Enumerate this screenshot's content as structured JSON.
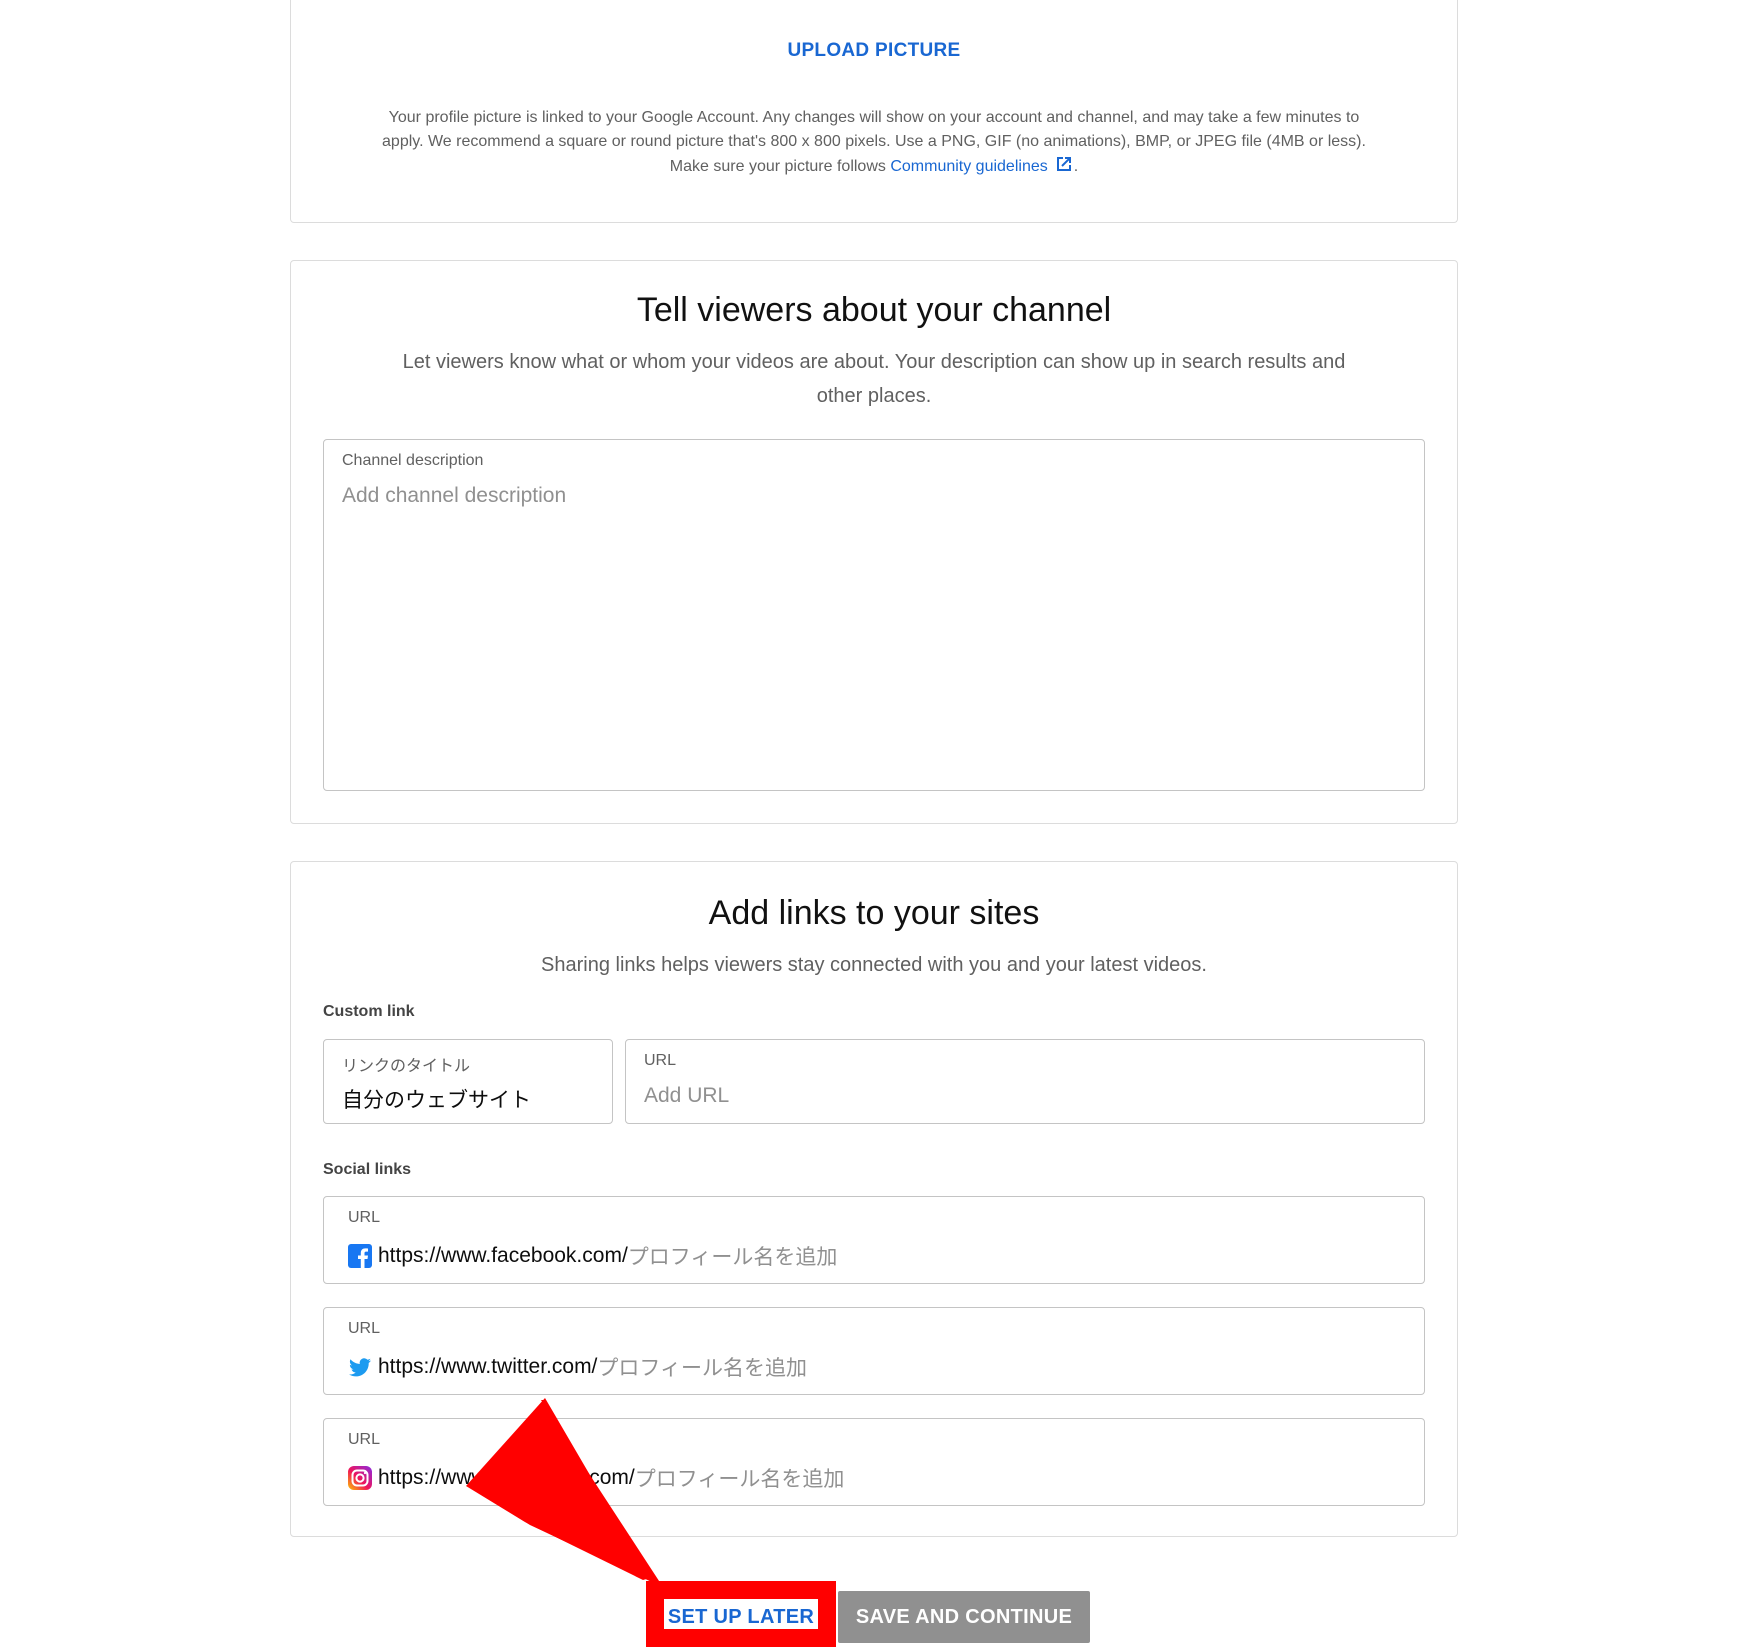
{
  "profile_picture": {
    "upload_label": "UPLOAD PICTURE",
    "help_line1": "Your profile picture is linked to your Google Account. Any changes will show on your account and channel, and may take a few minutes to",
    "help_line2": "apply. We recommend a square or round picture that's 800 x 800 pixels. Use a PNG, GIF (no animations), BMP, or JPEG file (4MB or less).",
    "help_line3_prefix": "Make sure your picture follows ",
    "guidelines_link": "Community guidelines",
    "help_line3_suffix": ".",
    "avatar_color": "#0f8a7d"
  },
  "about": {
    "title": "Tell viewers about your channel",
    "subtitle": "Let viewers know what or whom your videos are about. Your description can show up in search results and other places.",
    "description_label": "Channel description",
    "description_placeholder": "Add channel description"
  },
  "links": {
    "title": "Add links to your sites",
    "subtitle": "Sharing links helps viewers stay connected with you and your latest videos.",
    "custom_link_label": "Custom link",
    "link_title_label": "リンクのタイトル",
    "link_title_value": "自分のウェブサイト",
    "url_label": "URL",
    "url_placeholder": "Add URL",
    "social_links_label": "Social links",
    "social": [
      {
        "label": "URL",
        "prefix": "https://www.facebook.com/",
        "placeholder": "プロフィール名を追加",
        "icon": "facebook-icon"
      },
      {
        "label": "URL",
        "prefix": "https://www.twitter.com/",
        "placeholder": "プロフィール名を追加",
        "icon": "twitter-icon"
      },
      {
        "label": "URL",
        "prefix": "https://www.instagram.com/",
        "placeholder": "プロフィール名を追加",
        "icon": "instagram-icon"
      }
    ]
  },
  "actions": {
    "set_up_later": "SET UP LATER",
    "save_and_continue": "SAVE AND CONTINUE"
  },
  "colors": {
    "accent": "#1967d2",
    "annotation": "#ff0000",
    "disabled_button": "#909090"
  }
}
